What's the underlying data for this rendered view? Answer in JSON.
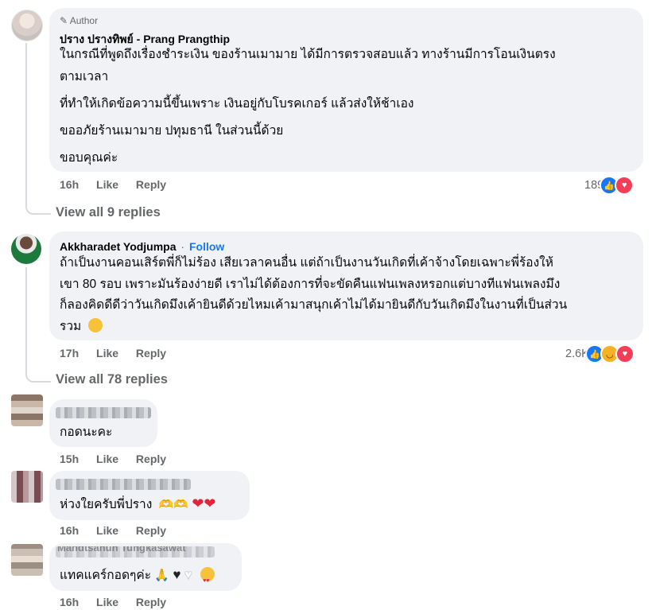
{
  "comments": [
    {
      "badge": "Author",
      "name": "ปราง ปรางทิพย์ - Prang Prangthip",
      "paragraphs": [
        "ในกรณีที่พูดถึงเรื่องชำระเงิน ของร้านเมามาย ได้มีการตรวจสอบแล้ว ทางร้านมีการโอนเงินตรง",
        "ตามเวลา",
        "ที่ทำให้เกิดข้อความนี้ขึ้นเพราะ เงินอยู่กับโบรคเกอร์ แล้วส่งให้ช้าเอง",
        "ขออภัยร้านเมามาย ปทุมธานี ในส่วนนี้ด้วย",
        "ขอบคุณค่ะ"
      ],
      "time": "16h",
      "like_label": "Like",
      "reply_label": "Reply",
      "reaction_count": "189",
      "reactions": [
        "like-icon",
        "love-icon"
      ],
      "view_replies": "View all 9 replies"
    },
    {
      "name": "Akkharadet Yodjumpa",
      "separator": "·",
      "follow_label": "Follow",
      "paragraphs": [
        "ถ้าเป็นงานคอนเสิร์ตพี่ก็ไม่ร้อง เสียเวลาคนอื่น แต่ถ้าเป็นงานวันเกิดที่เค้าจ้างโดยเฉพาะพี่ร้องให้",
        "เขา 80 รอบ เพราะมันร้องง่ายดี เราไม่ได้ต้องการที่จะขัดคืนแฟนเพลงหรอกแต่บางทีแฟนเพลงมึง",
        "ก็ลองคิดดีดีว่าวันเกิดมึงเค้ายินดีด้วยไหมเค้ามาสนุกเค้าไม่ได้มายินดีกับวันเกิดมึงในงานที่เป็นส่วน",
        "รวม"
      ],
      "time": "17h",
      "like_label": "Like",
      "reply_label": "Reply",
      "reaction_count": "2.6K",
      "reactions": [
        "like-icon",
        "haha-icon",
        "love-icon"
      ],
      "view_replies": "View all 78 replies"
    },
    {
      "text": "กอดนะคะ",
      "time": "15h",
      "like_label": "Like",
      "reply_label": "Reply"
    },
    {
      "text": "ห่วงใยครับพี่ปราง",
      "time": "16h",
      "like_label": "Like",
      "reply_label": "Reply"
    },
    {
      "name_fragment": "Mandtsanun Tungkasawat",
      "text": "แทคแคร์กอดๆค่ะ",
      "time": "16h",
      "like_label": "Like",
      "reply_label": "Reply"
    }
  ],
  "colors": {
    "bubble": "#f0f2f5",
    "meta_text": "#65676b",
    "link": "#1877f2",
    "like": "#1877f2",
    "love": "#f33e58",
    "haha": "#f7b125"
  }
}
